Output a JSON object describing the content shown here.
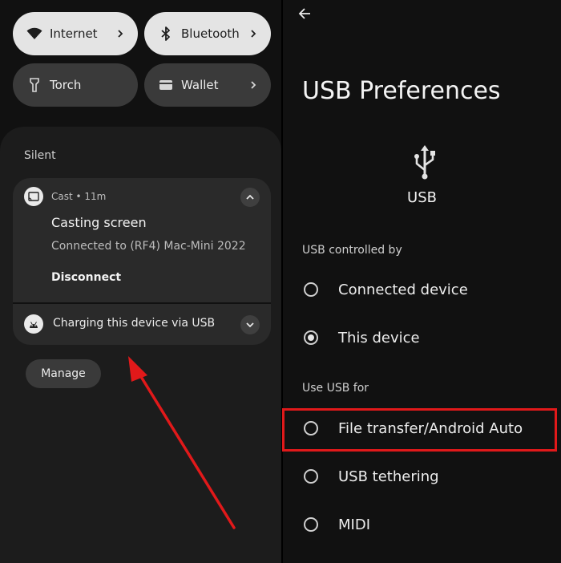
{
  "quick_settings": {
    "tiles": [
      {
        "label": "Internet",
        "icon": "wifi-icon",
        "state": "on",
        "has_chevron": true
      },
      {
        "label": "Bluetooth",
        "icon": "bluetooth-icon",
        "state": "on",
        "has_chevron": true
      },
      {
        "label": "Torch",
        "icon": "torch-icon",
        "state": "off",
        "has_chevron": false
      },
      {
        "label": "Wallet",
        "icon": "wallet-icon",
        "state": "off",
        "has_chevron": true
      }
    ]
  },
  "notifications": {
    "section_label": "Silent",
    "cast": {
      "meta": "Cast • 11m",
      "title": "Casting screen",
      "subtitle": "Connected to (RF4) Mac-Mini 2022",
      "action": "Disconnect"
    },
    "charging": {
      "title": "Charging this device via USB"
    },
    "manage_label": "Manage"
  },
  "usb_preferences": {
    "title": "USB Preferences",
    "icon": "usb-icon",
    "icon_label": "USB",
    "controlled_by": {
      "heading": "USB controlled by",
      "options": [
        {
          "label": "Connected device",
          "selected": false
        },
        {
          "label": "This device",
          "selected": true
        }
      ]
    },
    "use_for": {
      "heading": "Use USB for",
      "options": [
        {
          "label": "File transfer/Android Auto",
          "selected": false
        },
        {
          "label": "USB tethering",
          "selected": false
        },
        {
          "label": "MIDI",
          "selected": false
        }
      ]
    }
  },
  "annotations": {
    "accent_color": "#e1191a",
    "highlighted_option": "File transfer/Android Auto"
  }
}
